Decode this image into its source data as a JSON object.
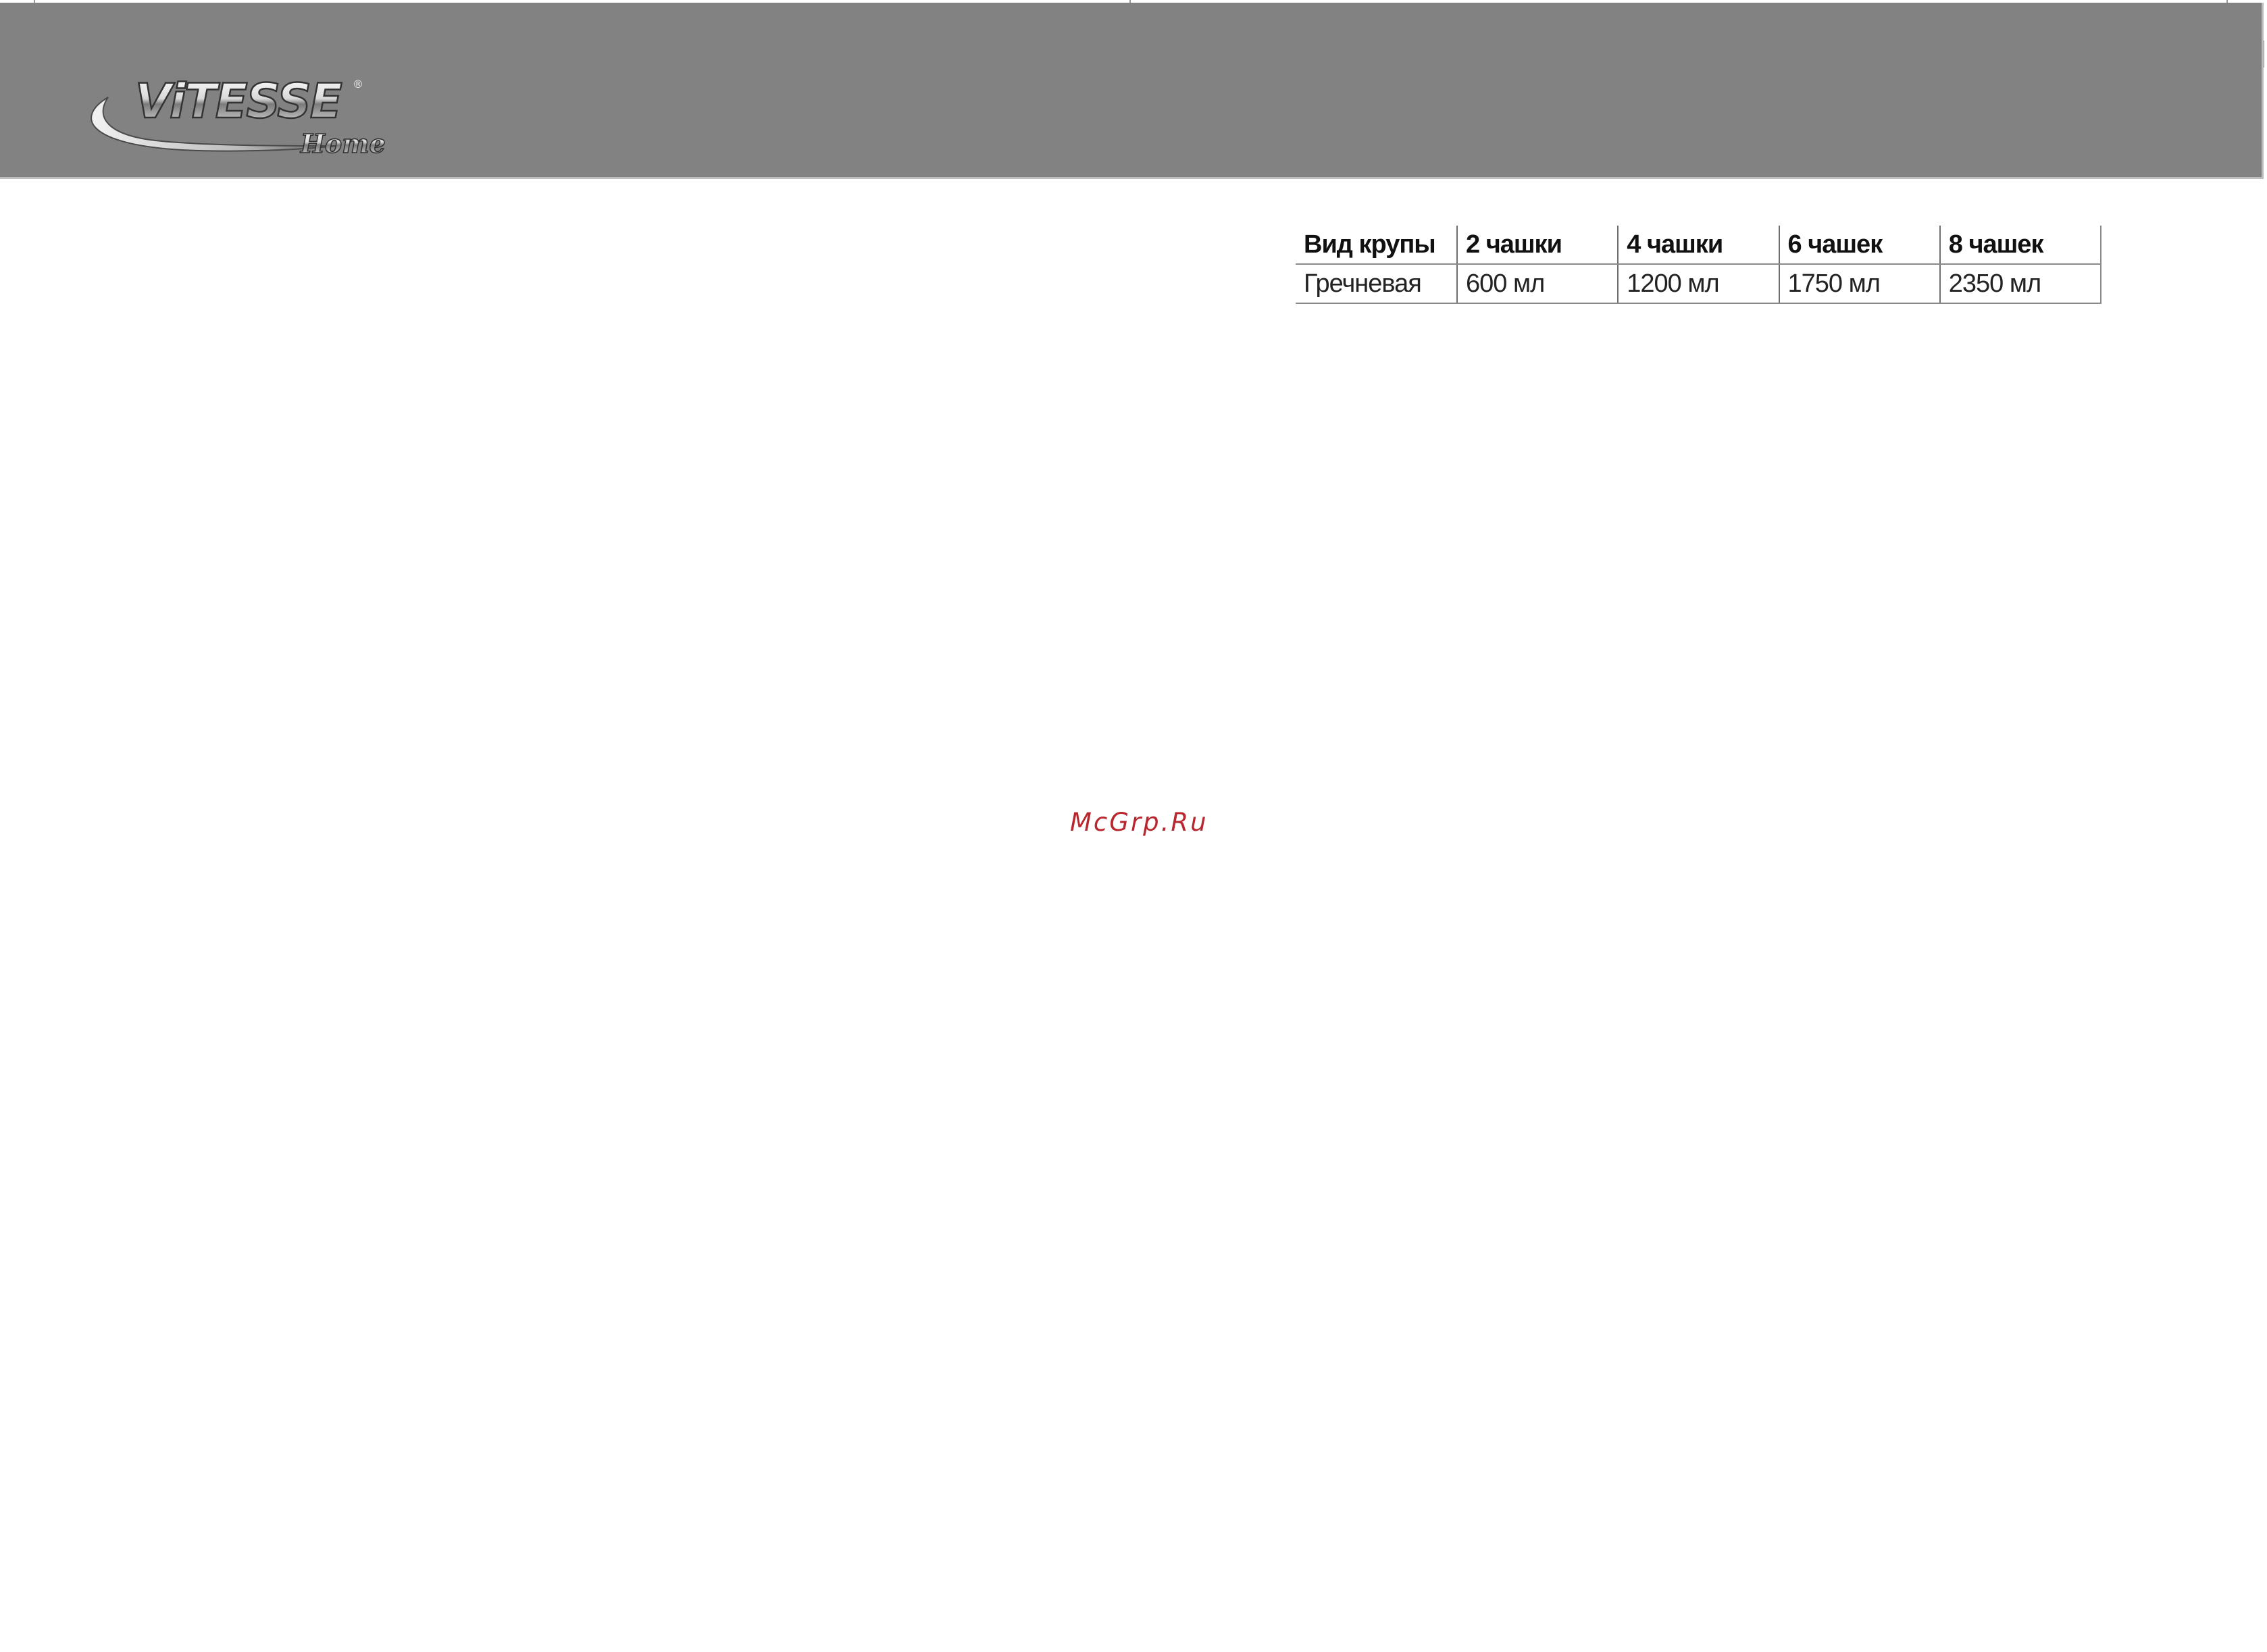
{
  "header": {
    "background_color": "#828282",
    "logo": {
      "brand": "VITESSE",
      "sub": "Home",
      "icon": "vitesse-home-logo"
    }
  },
  "table": {
    "headers": [
      "Вид крупы",
      "2 чашки",
      "4 чашки",
      "6 чашек",
      "8 чашек"
    ],
    "rows": [
      [
        "Гречневая",
        "600 мл",
        "1200 мл",
        "1750 мл",
        "2350 мл"
      ]
    ]
  },
  "watermark": {
    "text": "McGrp.Ru",
    "color": "#b8262e"
  }
}
